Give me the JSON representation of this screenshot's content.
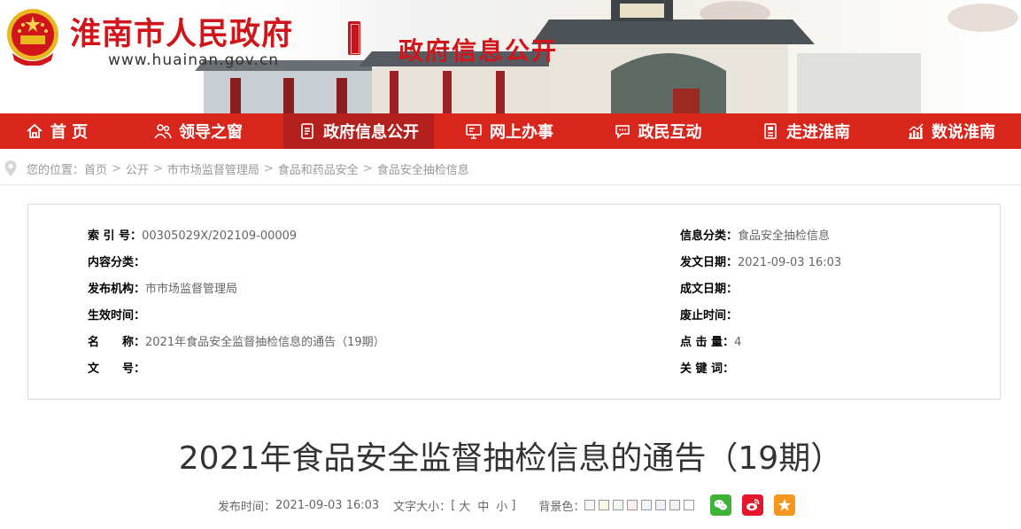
{
  "header": {
    "site_title": "淮南市人民政府",
    "site_url": "www.huainan.gov.cn",
    "section_title": "政府信息公开"
  },
  "nav": {
    "items": [
      {
        "label": "首 页",
        "icon": "home-icon"
      },
      {
        "label": "领导之窗",
        "icon": "people-icon"
      },
      {
        "label": "政府信息公开",
        "icon": "document-icon",
        "active": true
      },
      {
        "label": "网上办事",
        "icon": "monitor-icon"
      },
      {
        "label": "政民互动",
        "icon": "chat-icon"
      },
      {
        "label": "走进淮南",
        "icon": "book-icon"
      },
      {
        "label": "数说淮南",
        "icon": "chart-icon"
      }
    ]
  },
  "breadcrumb": {
    "label": "您的位置：",
    "items": [
      "首页",
      "公开",
      "市市场监督管理局",
      "食品和药品安全",
      "食品安全抽检信息"
    ],
    "separator": ">"
  },
  "info": {
    "index_no_key": "索 引 号：",
    "index_no_val": "00305029X/202109-00009",
    "category_key": "信息分类：",
    "category_val": "食品安全抽检信息",
    "content_class_key": "内容分类：",
    "content_class_val": "",
    "issue_date_key": "发文日期：",
    "issue_date_val": "2021-09-03 16:03",
    "publisher_key": "发布机构：",
    "publisher_val": "市市场监督管理局",
    "written_date_key": "成文日期：",
    "written_date_val": "",
    "effective_key": "生效时间：",
    "effective_val": "",
    "abolish_key": "废止时间：",
    "abolish_val": "",
    "name_key": "名　　称：",
    "name_val": "2021年食品安全监督抽检信息的通告（19期）",
    "clicks_key": "点 击 量：",
    "clicks_val": "4",
    "doc_no_key": "文　　号：",
    "doc_no_val": "",
    "keywords_key": "关 键 词：",
    "keywords_val": ""
  },
  "article": {
    "title": "2021年食品安全监督抽检信息的通告（19期）",
    "publish_time_label": "发布时间：",
    "publish_time": "2021-09-03 16:03",
    "font_size_label": "文字大小：",
    "bracket_open": "[",
    "bracket_close": "]",
    "sizes": [
      "大",
      "中",
      "小"
    ],
    "bg_label": "背景色：",
    "bg_colors": [
      "#f8f8f8",
      "#fafae6",
      "#f0f8f0",
      "#fbeeee",
      "#eef6fb",
      "#f2eef8",
      "#f0f0f0",
      "#ffffff"
    ]
  },
  "share": {
    "wechat_color": "#3fb337",
    "weibo_color": "#e6162d",
    "favorite_color": "#f5961e"
  }
}
